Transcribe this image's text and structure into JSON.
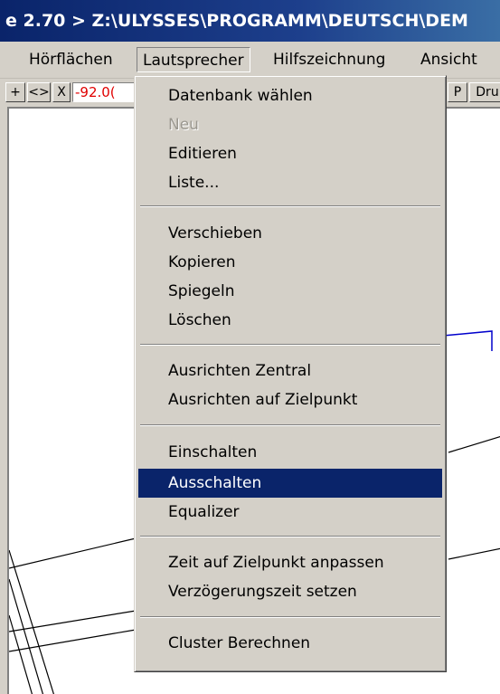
{
  "window": {
    "title": "e 2.70 > Z:\\ULYSSES\\PROGRAMM\\DEUTSCH\\DEM"
  },
  "menubar": {
    "items": [
      {
        "label": "Hörflächen"
      },
      {
        "label": "Lautsprecher"
      },
      {
        "label": "Hilfszeichnung"
      },
      {
        "label": "Ansicht"
      }
    ]
  },
  "toolbar": {
    "btn_plus": "+",
    "btn_arrows": "<>",
    "btn_x": "X",
    "coord_value": "-92.0(",
    "btn_p": "P",
    "btn_dru": "Dru"
  },
  "dropdown": {
    "items": [
      {
        "label": "Datenbank wählen"
      },
      {
        "label": "Neu"
      },
      {
        "label": "Editieren"
      },
      {
        "label": "Liste..."
      },
      {
        "label": "Verschieben"
      },
      {
        "label": "Kopieren"
      },
      {
        "label": "Spiegeln"
      },
      {
        "label": "Löschen"
      },
      {
        "label": "Ausrichten Zentral"
      },
      {
        "label": "Ausrichten auf Zielpunkt"
      },
      {
        "label": "Einschalten"
      },
      {
        "label": "Ausschalten"
      },
      {
        "label": "Equalizer"
      },
      {
        "label": "Zeit auf Zielpunkt anpassen"
      },
      {
        "label": "Verzögerungszeit setzen"
      },
      {
        "label": "Cluster Berechnen"
      }
    ]
  },
  "colors": {
    "title_bg": "#0a246a",
    "highlight": "#0a246a",
    "coord_text": "#e00000",
    "drawing_blue": "#0000cc"
  }
}
